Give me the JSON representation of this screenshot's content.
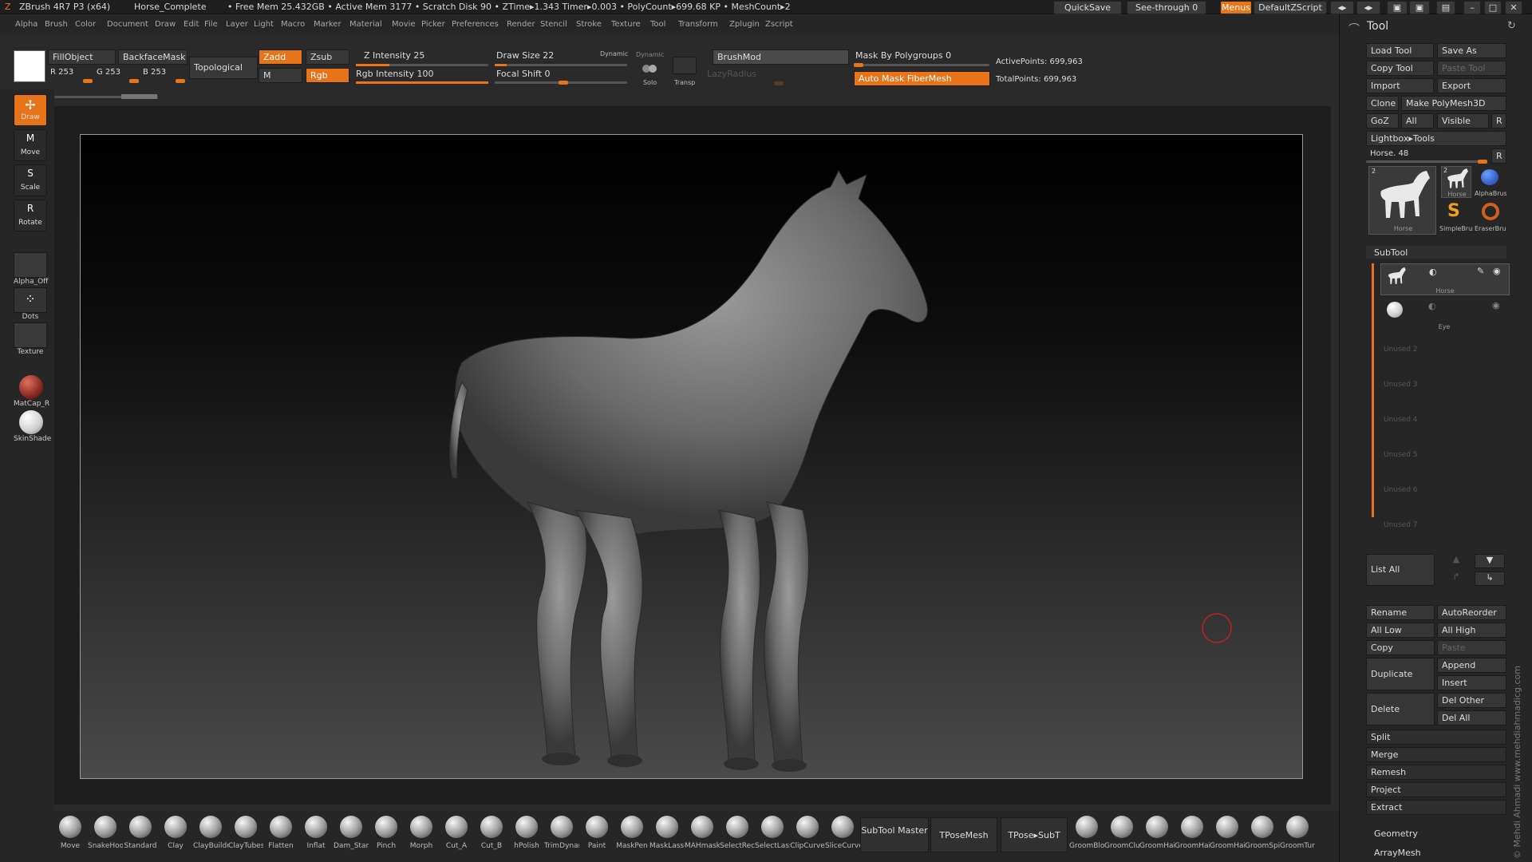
{
  "titlebar": {
    "app": "ZBrush 4R7 P3 (x64)",
    "doc": "Horse_Complete",
    "stats": "• Free Mem 25.432GB • Active Mem 3177 • Scratch Disk 90 • ZTime▸1.343 Timer▸0.003 • PolyCount▸699.68 KP • MeshCount▸2",
    "quicksave": "QuickSave",
    "seethrough": "See-through  0",
    "menus": "Menus",
    "script": "DefaultZScript"
  },
  "menubar": [
    "Alpha",
    "Brush",
    "Color",
    "Document",
    "Draw",
    "Edit",
    "File",
    "Layer",
    "Light",
    "Macro",
    "Marker",
    "Material",
    "Movie",
    "Picker",
    "Preferences",
    "Render",
    "Stencil",
    "Stroke",
    "Texture",
    "Tool",
    "Transform",
    "Zplugin",
    "Zscript"
  ],
  "topshelf": {
    "fillobject": "FillObject",
    "backfacemask": "BackfaceMask",
    "topological": "Topological",
    "r": "R 253",
    "g": "G 253",
    "b": "B 253",
    "zadd": "Zadd",
    "zsub": "Zsub",
    "m": "M",
    "rgb": "Rgb",
    "z_intensity": "Z Intensity 25",
    "rgb_intensity": "Rgb Intensity 100",
    "draw_size": "Draw Size 22",
    "focal_shift": "Focal Shift 0",
    "dynamic": "Dynamic",
    "solo_dyn": "Dynamic",
    "solo": "Solo",
    "transp": "Transp",
    "brushmod": "BrushMod",
    "lazyradius": "LazyRadius",
    "mask_polygroups": "Mask By Polygroups 0",
    "automask": "Auto Mask FiberMesh",
    "activepoints": "ActivePoints: 699,963",
    "totalpoints": "TotalPoints: 699,963",
    "z_intensity_value": 25,
    "rgb_intensity_value": 100,
    "draw_size_value": 22,
    "colors": {
      "accent": "#e8741a"
    }
  },
  "lefttray": {
    "draw": "Draw",
    "move": "Move",
    "scale": "Scale",
    "rotate": "Rotate",
    "alpha": "Alpha_Off",
    "dots": "Dots",
    "texture": "Texture",
    "matcap": "MatCap_R",
    "skinshade": "SkinShade",
    "move_key": "M",
    "scale_key": "S",
    "rotate_key": "R"
  },
  "bottomshelf": {
    "brushes": [
      "Move",
      "SnakeHook",
      "Standard",
      "Clay",
      "ClayBuildup",
      "ClayTubes",
      "Flatten",
      "Inflat",
      "Dam_Standard",
      "Pinch",
      "Morph",
      "Cut_A",
      "Cut_B",
      "hPolish",
      "TrimDynamic",
      "Paint",
      "MaskPen",
      "MaskLasso",
      "MAHmask",
      "SelectRect",
      "SelectLasso",
      "ClipCurve",
      "SliceCurve"
    ],
    "subtool_master": "SubTool Master",
    "tpose_mesh": "TPoseMesh",
    "tpose_subt": "TPose▸SubT",
    "groom": [
      "GroomBlower",
      "GroomClump",
      "GroomHairLong",
      "GroomHairShort",
      "GroomHairToss",
      "GroomSpike",
      "GroomTurbulence"
    ]
  },
  "toolpanel": {
    "title": "Tool",
    "load_tool": "Load Tool",
    "save_as": "Save As",
    "copy_tool": "Copy Tool",
    "paste_tool": "Paste Tool",
    "import": "Import",
    "export": "Export",
    "clone": "Clone",
    "make_polymesh": "Make PolyMesh3D",
    "goz": "GoZ",
    "all": "All",
    "visible": "Visible",
    "r": "R",
    "lightbox": "Lightbox▸Tools",
    "horse_slider": "Horse. 48",
    "r2": "R",
    "thumb_main": "Horse",
    "thumb_horse": "Horse",
    "thumb_alpha": "AlphaBrush",
    "thumb_simple": "SimpleBrush",
    "thumb_eraser": "EraserBrush",
    "badge_main": "2",
    "badge_horse": "2",
    "subtool": "SubTool",
    "subtools": [
      "Horse",
      "Eye"
    ],
    "unused": [
      "Unused 2",
      "Unused 3",
      "Unused 4",
      "Unused 5",
      "Unused 6",
      "Unused 7"
    ],
    "list_all": "List All",
    "rename": "Rename",
    "autoreorder": "AutoReorder",
    "all_low": "All Low",
    "all_high": "All High",
    "copy": "Copy",
    "paste": "Paste",
    "duplicate": "Duplicate",
    "append": "Append",
    "insert": "Insert",
    "delete": "Delete",
    "del_other": "Del Other",
    "del_all": "Del All",
    "split": "Split",
    "merge": "Merge",
    "remesh": "Remesh",
    "project": "Project",
    "extract": "Extract",
    "geometry": "Geometry",
    "arraymesh": "ArrayMesh"
  },
  "watermark": "© Mehdi Ahmadi  www.mehdiahmadicg.com"
}
